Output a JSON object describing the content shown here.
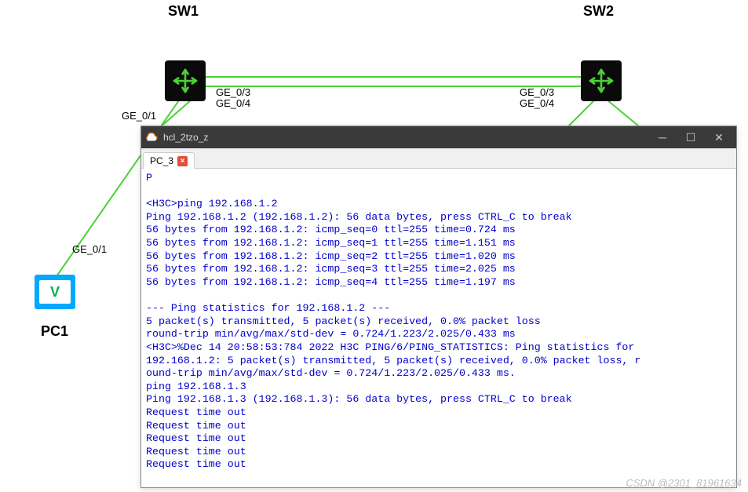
{
  "topology": {
    "devices": {
      "sw1": {
        "label": "SW1"
      },
      "sw2": {
        "label": "SW2"
      },
      "pc1": {
        "label": "PC1"
      }
    },
    "ports": {
      "sw1_ge01": "GE_0/1",
      "sw1_ge03": "GE_0/3",
      "sw1_ge04": "GE_0/4",
      "sw2_ge03": "GE_0/3",
      "sw2_ge04": "GE_0/4",
      "pc1_ge01": "GE_0/1"
    }
  },
  "terminal": {
    "title": "hcl_2tzo_z",
    "tab": {
      "label": "PC_3"
    },
    "lines": [
      "P",
      "",
      "<H3C>ping 192.168.1.2",
      "Ping 192.168.1.2 (192.168.1.2): 56 data bytes, press CTRL_C to break",
      "56 bytes from 192.168.1.2: icmp_seq=0 ttl=255 time=0.724 ms",
      "56 bytes from 192.168.1.2: icmp_seq=1 ttl=255 time=1.151 ms",
      "56 bytes from 192.168.1.2: icmp_seq=2 ttl=255 time=1.020 ms",
      "56 bytes from 192.168.1.2: icmp_seq=3 ttl=255 time=2.025 ms",
      "56 bytes from 192.168.1.2: icmp_seq=4 ttl=255 time=1.197 ms",
      "",
      "--- Ping statistics for 192.168.1.2 ---",
      "5 packet(s) transmitted, 5 packet(s) received, 0.0% packet loss",
      "round-trip min/avg/max/std-dev = 0.724/1.223/2.025/0.433 ms",
      "<H3C>%Dec 14 20:58:53:784 2022 H3C PING/6/PING_STATISTICS: Ping statistics for",
      "192.168.1.2: 5 packet(s) transmitted, 5 packet(s) received, 0.0% packet loss, r",
      "ound-trip min/avg/max/std-dev = 0.724/1.223/2.025/0.433 ms.",
      "ping 192.168.1.3",
      "Ping 192.168.1.3 (192.168.1.3): 56 data bytes, press CTRL_C to break",
      "Request time out",
      "Request time out",
      "Request time out",
      "Request time out",
      "Request time out"
    ]
  },
  "watermark": "CSDN @2301_81961634"
}
